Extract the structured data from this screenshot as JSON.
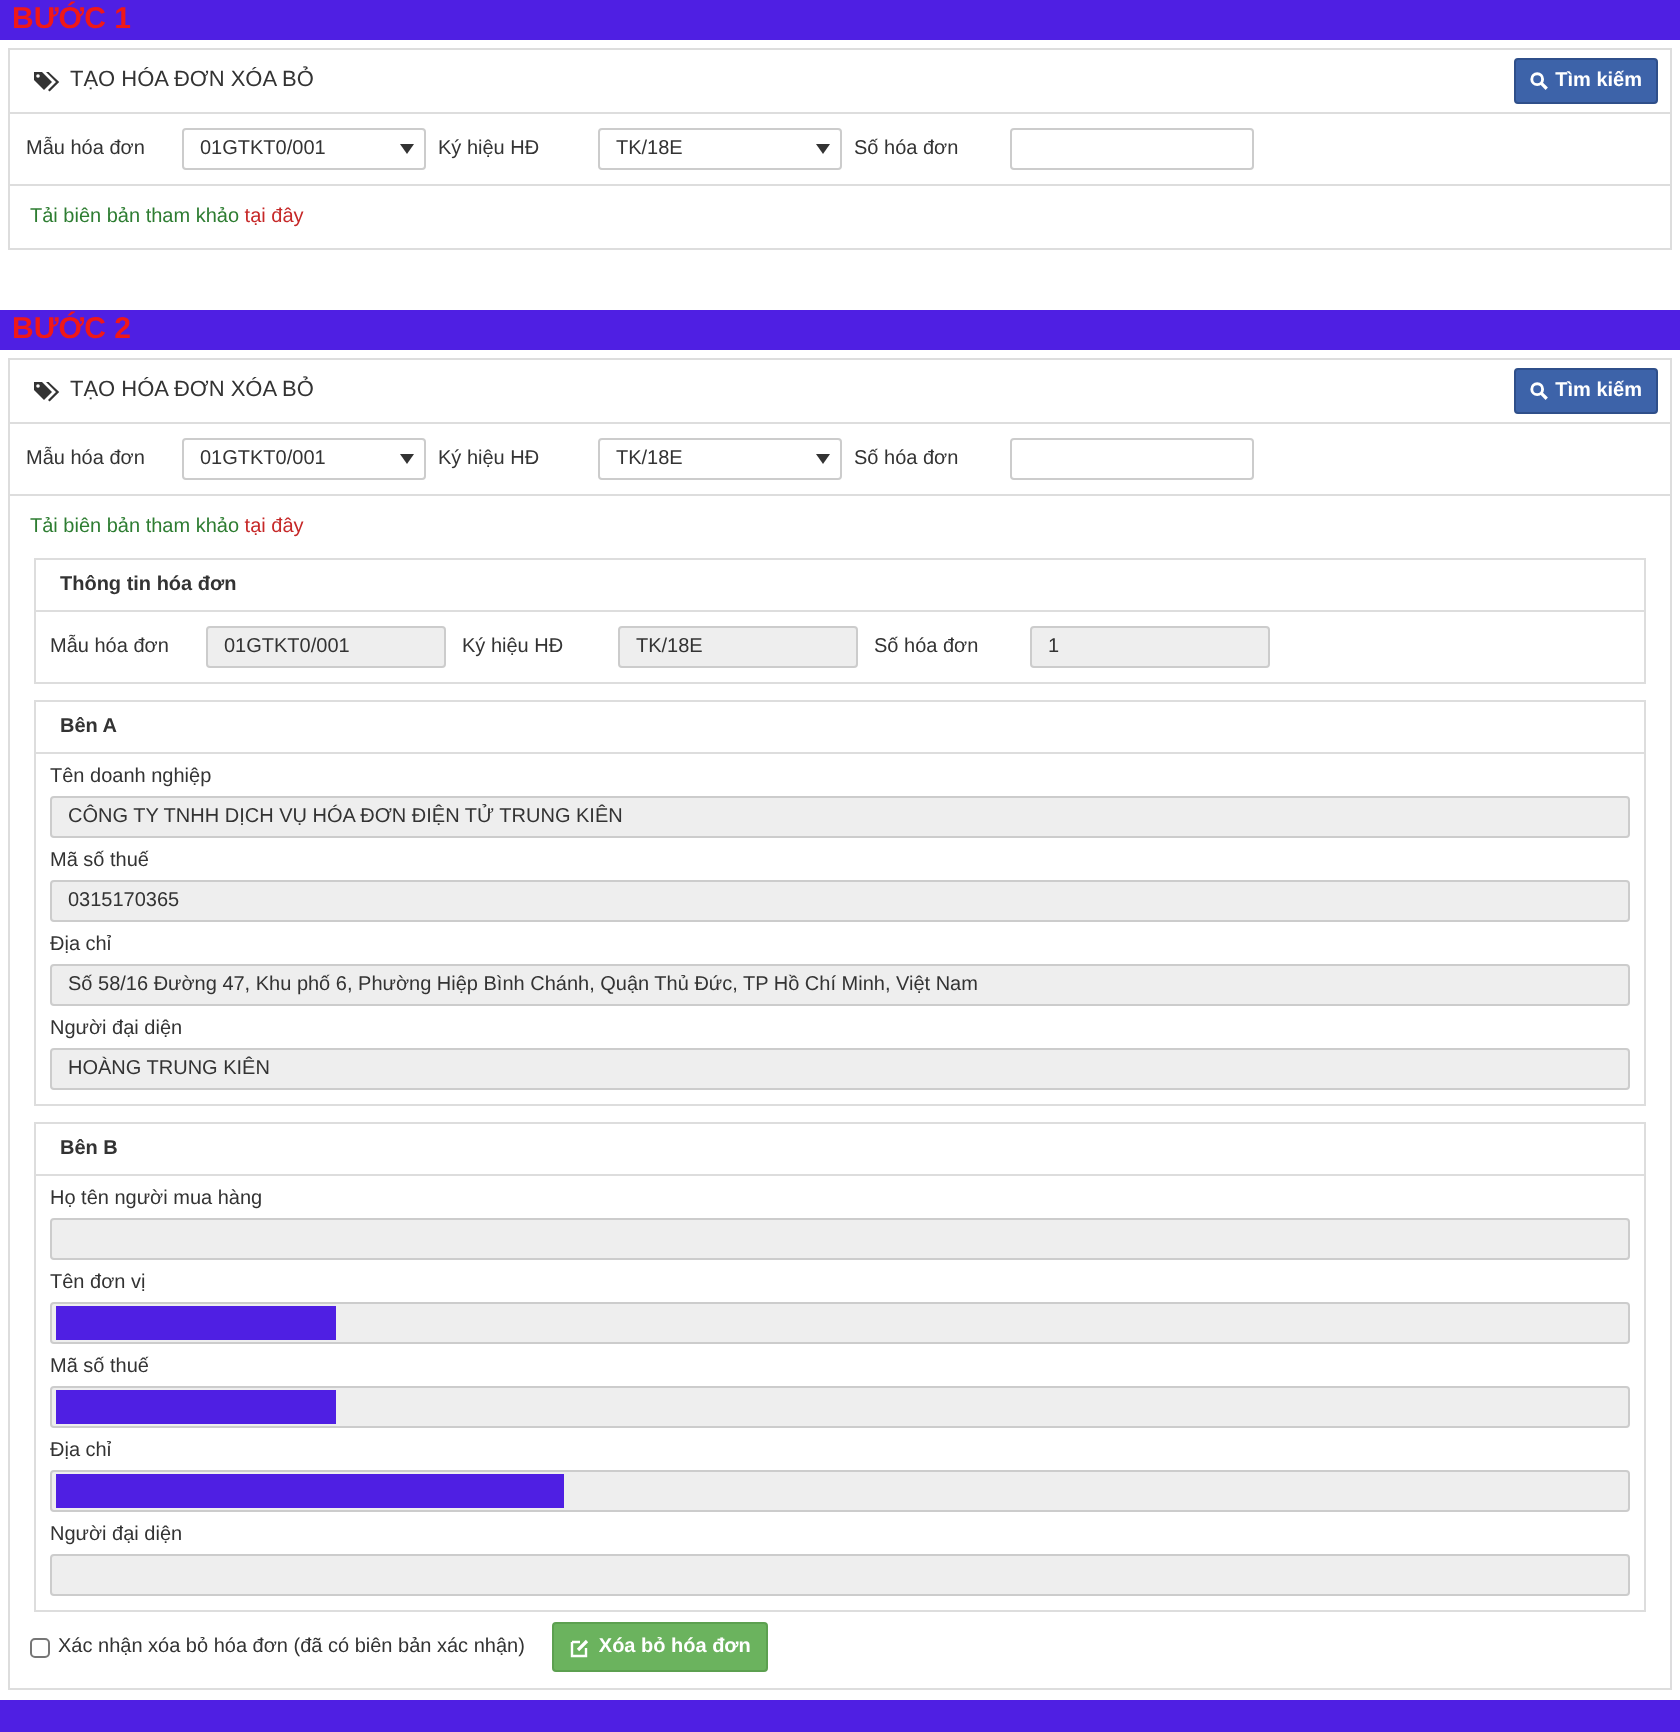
{
  "steps": [
    {
      "label": "BƯỚC 1",
      "panel": {
        "title": "TẠO HÓA ĐƠN XÓA BỎ",
        "search_button": "Tìm kiếm",
        "filters": [
          {
            "label": "Mẫu hóa đơn",
            "kind": "select",
            "value": "01GTKT0/001"
          },
          {
            "label": "Ký hiệu HĐ",
            "kind": "select",
            "value": "TK/18E"
          },
          {
            "label": "Số hóa đơn",
            "kind": "input"
          }
        ],
        "download_text": "Tải biên bản tham khảo",
        "download_link": "tại đây"
      }
    },
    {
      "label": "BƯỚC 2",
      "panel": {
        "title": "TẠO HÓA ĐƠN XÓA BỎ",
        "search_button": "Tìm kiếm",
        "filters": [
          {
            "label": "Mẫu hóa đơn",
            "kind": "select",
            "value": "01GTKT0/001"
          },
          {
            "label": "Ký hiệu HĐ",
            "kind": "select",
            "value": "TK/18E"
          },
          {
            "label": "Số hóa đơn",
            "kind": "input"
          }
        ],
        "download_text": "Tải biên bản tham khảo",
        "download_link": "tại đây"
      },
      "invoice_info": {
        "title": "Thông tin hóa đơn",
        "fields": [
          {
            "label": "Mẫu hóa đơn",
            "value": "01GTKT0/001"
          },
          {
            "label": "Ký hiệu HĐ",
            "value": "TK/18E"
          },
          {
            "label": "Số hóa đơn",
            "value": "1"
          }
        ]
      },
      "parties": [
        {
          "title": "Bên A",
          "fields": [
            {
              "label": "Tên doanh nghiệp",
              "value": "CÔNG TY TNHH DỊCH VỤ HÓA ĐƠN ĐIỆN TỬ TRUNG KIÊN"
            },
            {
              "label": "Mã số thuế",
              "value": "0315170365"
            },
            {
              "label": "Địa chỉ",
              "value": "Số 58/16 Đường 47, Khu phố 6, Phường Hiệp Bình Chánh, Quận Thủ Đức, TP Hồ Chí Minh, Việt Nam"
            },
            {
              "label": "Người đại diện",
              "value": "HOÀNG TRUNG KIÊN"
            }
          ]
        },
        {
          "title": "Bên B",
          "fields": [
            {
              "label": "Họ tên người mua hàng",
              "kind": "empty"
            },
            {
              "label": "Tên đơn vị",
              "kind": "redacted"
            },
            {
              "label": "Mã số thuế",
              "kind": "redacted"
            },
            {
              "label": "Địa chỉ",
              "kind": "redacted-wide"
            },
            {
              "label": "Người đại diện",
              "kind": "empty"
            }
          ]
        }
      ],
      "confirm": {
        "label": "Xác nhận xóa bỏ hóa đơn (đã có biên bản xác nhận)",
        "checked": false
      },
      "delete_button": "Xóa bỏ hóa đơn"
    }
  ]
}
